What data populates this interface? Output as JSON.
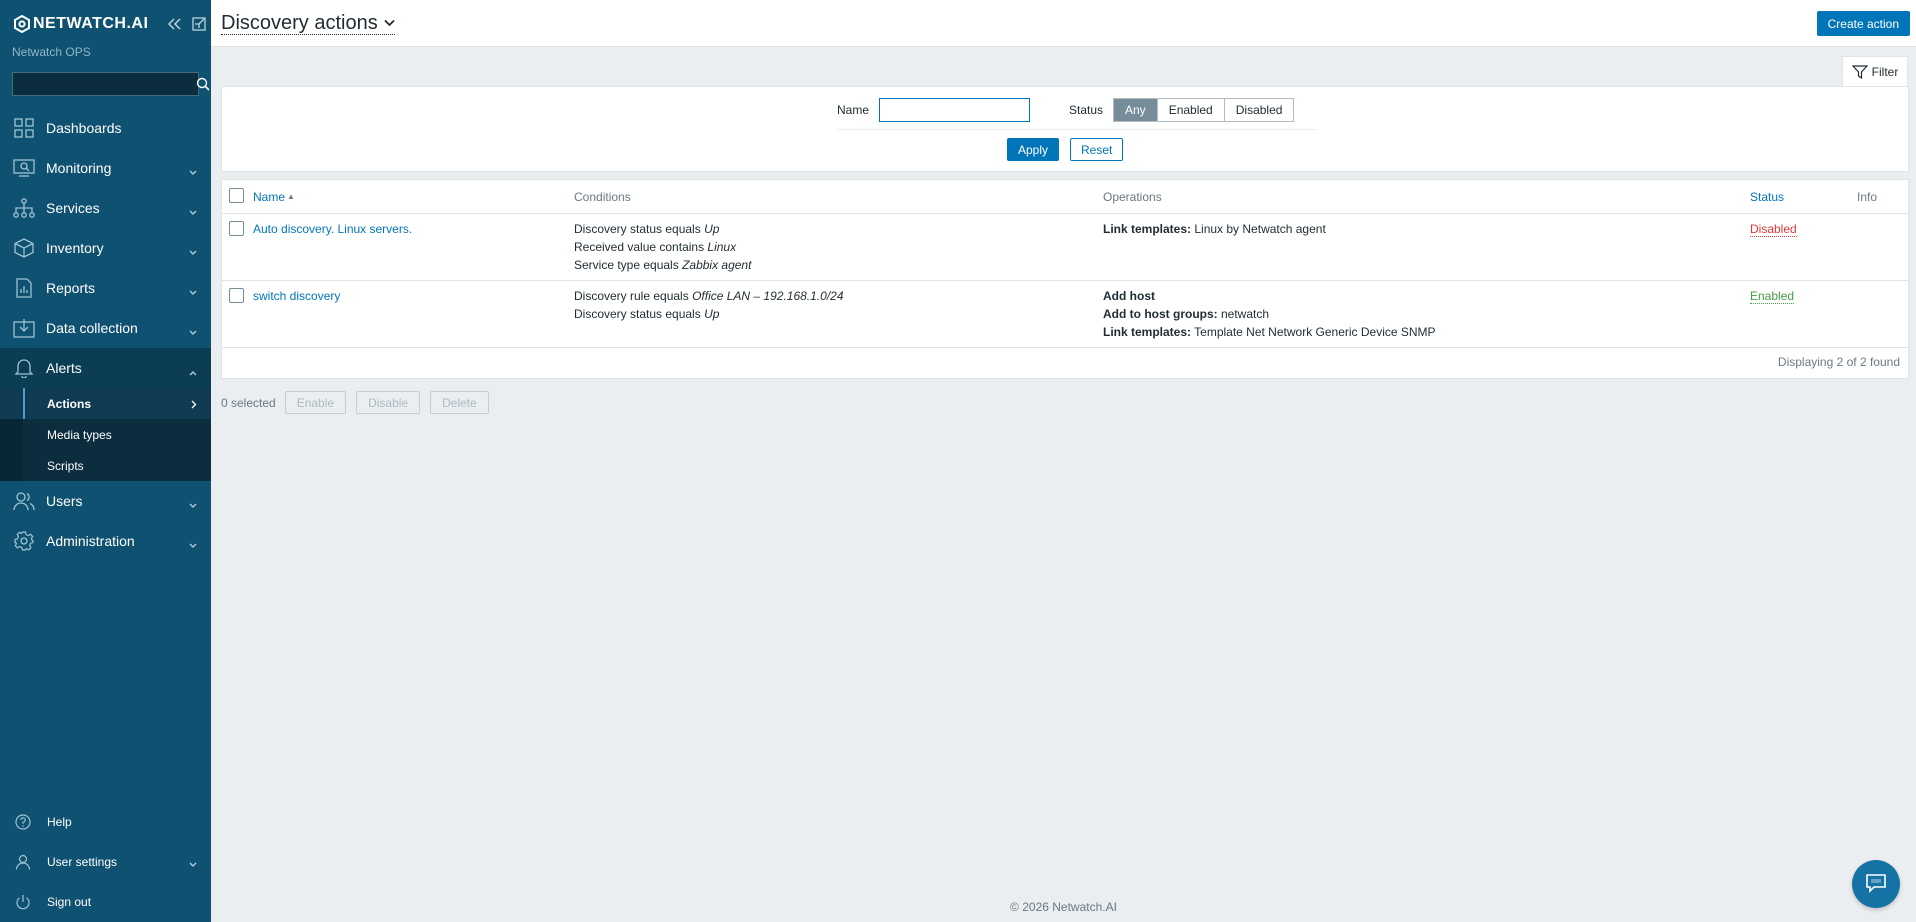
{
  "sidebar": {
    "logo_text": "NETWATCH.AI",
    "server_name": "Netwatch OPS",
    "search_placeholder": "",
    "menu": [
      {
        "label": "Dashboards",
        "icon": "dashboards-icon"
      },
      {
        "label": "Monitoring",
        "icon": "monitoring-icon"
      },
      {
        "label": "Services",
        "icon": "services-icon"
      },
      {
        "label": "Inventory",
        "icon": "inventory-icon"
      },
      {
        "label": "Reports",
        "icon": "reports-icon"
      },
      {
        "label": "Data collection",
        "icon": "data-collection-icon"
      },
      {
        "label": "Alerts",
        "icon": "alerts-icon"
      }
    ],
    "alerts_sub": [
      {
        "label": "Actions"
      },
      {
        "label": "Media types"
      },
      {
        "label": "Scripts"
      }
    ],
    "menu2": [
      {
        "label": "Users",
        "icon": "users-icon"
      },
      {
        "label": "Administration",
        "icon": "administration-icon"
      }
    ],
    "bottom": [
      {
        "label": "Help",
        "icon": "help-icon"
      },
      {
        "label": "User settings",
        "icon": "user-settings-icon"
      },
      {
        "label": "Sign out",
        "icon": "sign-out-icon"
      }
    ]
  },
  "header": {
    "title": "Discovery actions",
    "create_button": "Create action"
  },
  "filter": {
    "tab_label": "Filter",
    "name_label": "Name",
    "name_value": "",
    "status_label": "Status",
    "status_options": [
      "Any",
      "Enabled",
      "Disabled"
    ],
    "status_selected": "Any",
    "apply": "Apply",
    "reset": "Reset"
  },
  "table": {
    "columns": {
      "name": "Name",
      "conditions": "Conditions",
      "operations": "Operations",
      "status": "Status",
      "info": "Info"
    },
    "sort_indicator": "▲",
    "rows": [
      {
        "name": "Auto discovery. Linux servers.",
        "conditions": [
          {
            "text": "Discovery status equals ",
            "value": "Up"
          },
          {
            "text": "Received value contains ",
            "value": "Linux"
          },
          {
            "text": "Service type equals ",
            "value": "Zabbix agent"
          }
        ],
        "operations": [
          {
            "bold": "Link templates:",
            "text": " Linux by Netwatch agent"
          }
        ],
        "status": "Disabled"
      },
      {
        "name": "switch discovery",
        "conditions": [
          {
            "text": "Discovery rule equals ",
            "value": "Office LAN – 192.168.1.0/24"
          },
          {
            "text": "Discovery status equals ",
            "value": "Up"
          }
        ],
        "operations": [
          {
            "bold": "Add host",
            "text": ""
          },
          {
            "bold": "Add to host groups:",
            "text": " netwatch"
          },
          {
            "bold": "Link templates:",
            "text": " Template Net Network Generic Device SNMP"
          }
        ],
        "status": "Enabled"
      }
    ],
    "displaying": "Displaying 2 of 2 found"
  },
  "bulk": {
    "selected": "0 selected",
    "enable": "Enable",
    "disable": "Disable",
    "delete": "Delete"
  },
  "footer": "© 2026 Netwatch.AI",
  "colors": {
    "sidebar_bg": "#0f5170",
    "accent": "#0275b8",
    "disabled": "#e33734",
    "enabled": "#429e47"
  }
}
